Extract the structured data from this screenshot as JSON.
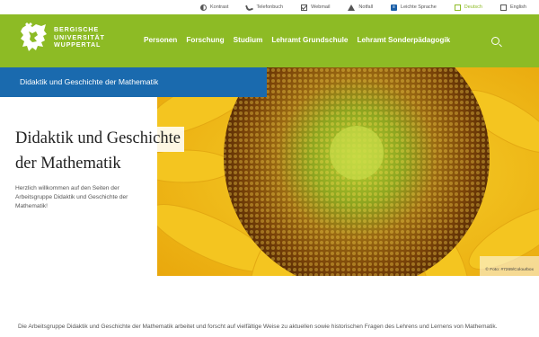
{
  "utility": [
    {
      "icon": "contrast-icon",
      "label": "Kontrast"
    },
    {
      "icon": "phone-icon",
      "label": "Telefonbuch"
    },
    {
      "icon": "mail-icon",
      "label": "Webmail"
    },
    {
      "icon": "alert-icon",
      "label": "Notfall"
    },
    {
      "icon": "easy-language-icon",
      "label": "Leichte Sprache"
    },
    {
      "icon": "flag-de-icon",
      "label": "Deutsch",
      "active": true
    },
    {
      "icon": "flag-en-icon",
      "label": "English"
    }
  ],
  "logo": {
    "line1": "BERGISCHE",
    "line2": "UNIVERSITÄT",
    "line3": "WUPPERTAL"
  },
  "nav": [
    "Personen",
    "Forschung",
    "Studium",
    "Lehramt Grundschule",
    "Lehramt Sonderpädagogik"
  ],
  "breadcrumb": "Didaktik und Geschichte der Mathematik",
  "hero": {
    "title_line1": "Didaktik und Geschichte",
    "title_line2": "der Mathematik",
    "intro": "Herzlich willkommen auf den Seiten der Arbeitsgruppe Didaktik und Geschichte der Mathematik!",
    "credit": "© Foto: #7269/Colourbox"
  },
  "body": "Die Arbeitsgruppe Didaktik und Geschichte der Mathematik arbeitet und forscht auf vielfältige Weise zu aktuellen sowie historischen Fragen des Lehrens und Lernens von Mathematik.",
  "colors": {
    "brand_green": "#8dbb25",
    "brand_blue": "#1a6aae"
  }
}
